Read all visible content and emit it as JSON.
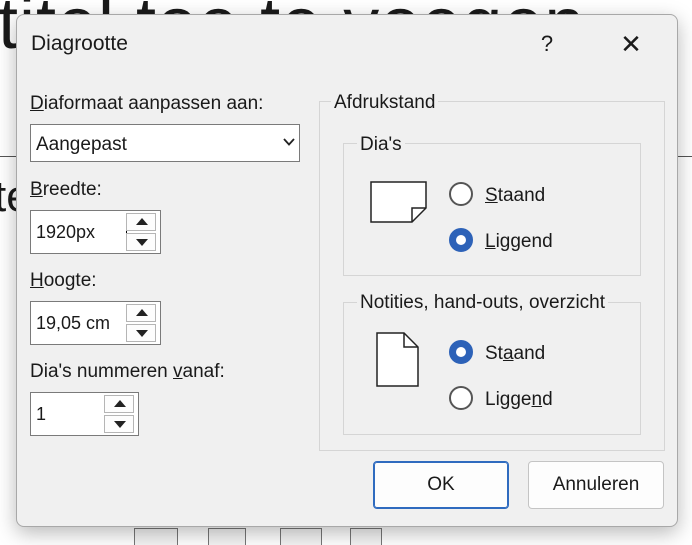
{
  "background": {
    "slide_title_fragment": "titel toe te voegen",
    "slide_text_fragment": "te"
  },
  "dialog": {
    "title": "Diagrootte",
    "help_label": "?",
    "close_label": "✕",
    "size_for": {
      "label_prefix": "D",
      "label_rest": "iaformaat aanpassen aan:",
      "selected": "Aangepast"
    },
    "width": {
      "label_prefix": "B",
      "label_rest": "reedte:",
      "value": "1920px"
    },
    "height": {
      "label_prefix": "H",
      "label_rest": "oogte:",
      "value": "19,05 cm"
    },
    "number_from": {
      "label_before": "Dia's nummeren ",
      "label_under": "v",
      "label_after": "anaf:",
      "value": "1"
    },
    "orientation": {
      "title": "Afdrukstand",
      "slides": {
        "title": "Dia's",
        "portrait": {
          "prefix": "S",
          "rest": "taand",
          "selected": false
        },
        "landscape": {
          "prefix": "L",
          "rest": "iggend",
          "selected": true
        }
      },
      "notes": {
        "title": "Notities, hand-outs, overzicht",
        "portrait": {
          "before": "St",
          "under": "a",
          "after": "and",
          "selected": true
        },
        "landscape": {
          "before": "Ligge",
          "under": "n",
          "after": "d",
          "selected": false
        }
      }
    },
    "ok_label": "OK",
    "cancel_label": "Annuleren"
  },
  "colors": {
    "accent": "#2d62b8",
    "dialog_bg": "#f0f0f0"
  }
}
